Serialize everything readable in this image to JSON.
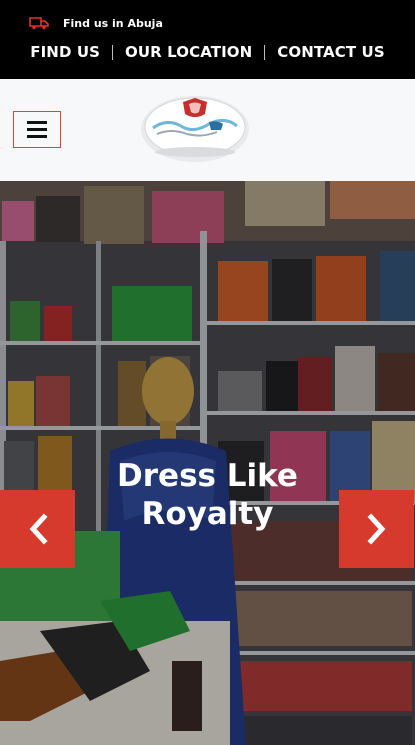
{
  "topbar": {
    "find_text": "Find us in Abuja",
    "nav": [
      {
        "label": "FIND US"
      },
      {
        "label": "OUR LOCATION"
      },
      {
        "label": "CONTACT US"
      }
    ]
  },
  "header": {
    "menu_icon": "hamburger-icon",
    "logo": "brand-logo"
  },
  "hero": {
    "headline_line1": "Dress Like",
    "headline_line2": "Royalty",
    "prev_icon": "chevron-left-icon",
    "next_icon": "chevron-right-icon"
  },
  "colors": {
    "topbar_bg": "#000000",
    "accent": "#d63a2c",
    "header_bg": "#f7f8fa"
  }
}
